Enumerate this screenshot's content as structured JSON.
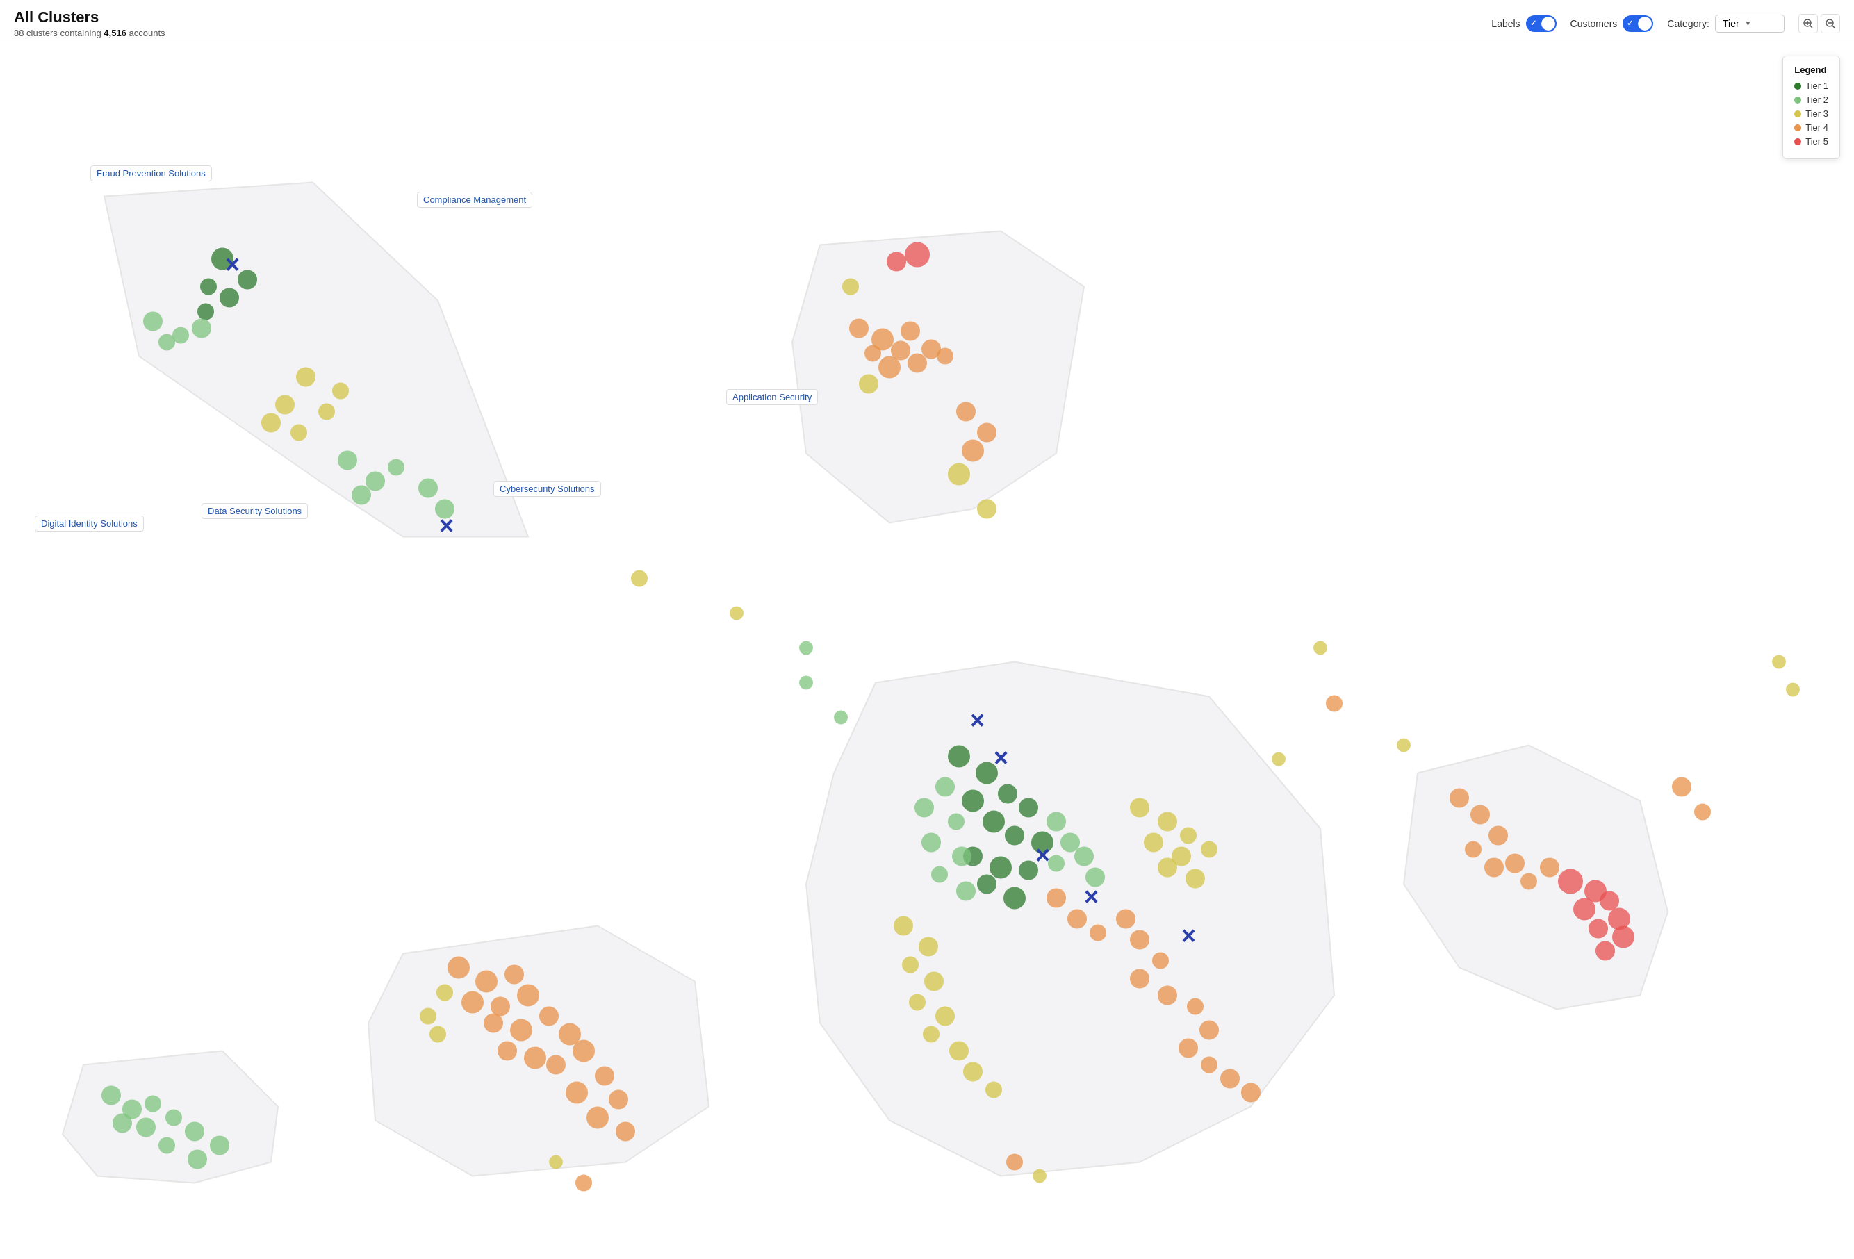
{
  "header": {
    "title": "All Clusters",
    "subtitle_prefix": "88 clusters containing ",
    "accounts_count": "4,516",
    "subtitle_suffix": " accounts",
    "labels_label": "Labels",
    "customers_label": "Customers",
    "category_label": "Category:",
    "category_value": "Tier",
    "zoom_in_label": "+",
    "zoom_out_label": "−"
  },
  "legend": {
    "title": "Legend",
    "items": [
      {
        "label": "Tier 1",
        "color": "#2d7a2d"
      },
      {
        "label": "Tier 2",
        "color": "#7dc47d"
      },
      {
        "label": "Tier 3",
        "color": "#d4c44a"
      },
      {
        "label": "Tier 4",
        "color": "#e8924a"
      },
      {
        "label": "Tier 5",
        "color": "#e85050"
      }
    ]
  },
  "clusters": [
    {
      "id": "fraud-prevention",
      "label": "Fraud Prevention Solutions",
      "labelX": 175,
      "labelY": 175
    },
    {
      "id": "compliance-management",
      "label": "Compliance Management",
      "labelX": 640,
      "labelY": 220
    },
    {
      "id": "cybersecurity-solutions",
      "label": "Cybersecurity Solutions",
      "labelX": 750,
      "labelY": 635
    },
    {
      "id": "application-security",
      "label": "Application Security",
      "labelX": 1080,
      "labelY": 505
    },
    {
      "id": "data-security",
      "label": "Data Security Solutions",
      "labelX": 305,
      "labelY": 665
    },
    {
      "id": "digital-identity",
      "label": "Digital Identity Solutions",
      "labelX": 75,
      "labelY": 680
    }
  ]
}
